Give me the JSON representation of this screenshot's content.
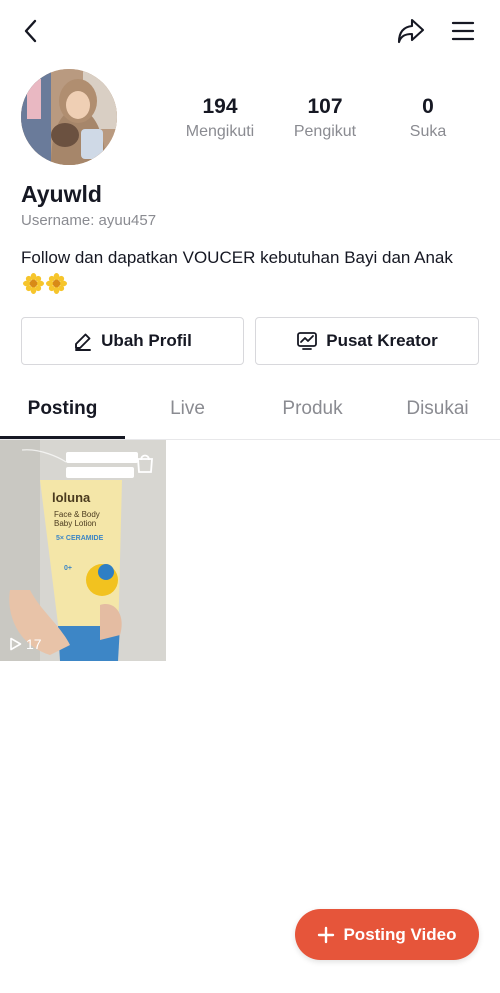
{
  "header": {
    "back_icon": "chevron-left-icon",
    "share_icon": "share-arrow-icon",
    "menu_icon": "hamburger-menu-icon"
  },
  "profile": {
    "name": "Ayuwld",
    "username": "Username: ayuu457",
    "bio": "Follow dan dapatkan VOUCER kebutuhan Bayi dan Anak",
    "bio_emoji": "sunflower-emoji x2"
  },
  "stats": [
    {
      "value": "194",
      "label": "Mengikuti"
    },
    {
      "value": "107",
      "label": "Pengikut"
    },
    {
      "value": "0",
      "label": "Suka"
    }
  ],
  "actions": {
    "edit_label": "Ubah Profil",
    "creator_label": "Pusat Kreator"
  },
  "tabs": [
    {
      "label": "Posting",
      "active": true
    },
    {
      "label": "Live",
      "active": false
    },
    {
      "label": "Produk",
      "active": false
    },
    {
      "label": "Disukai",
      "active": false
    }
  ],
  "posts": [
    {
      "views": "17",
      "product": {
        "brand": "loluna",
        "line1": "Face & Body",
        "line2": "Baby Lotion",
        "badge": "5× CERAMIDE",
        "age": "0+"
      }
    }
  ],
  "fab": {
    "label": "Posting Video"
  },
  "colors": {
    "accent": "#e6553a",
    "text": "#161823",
    "muted": "#8a8b91"
  }
}
